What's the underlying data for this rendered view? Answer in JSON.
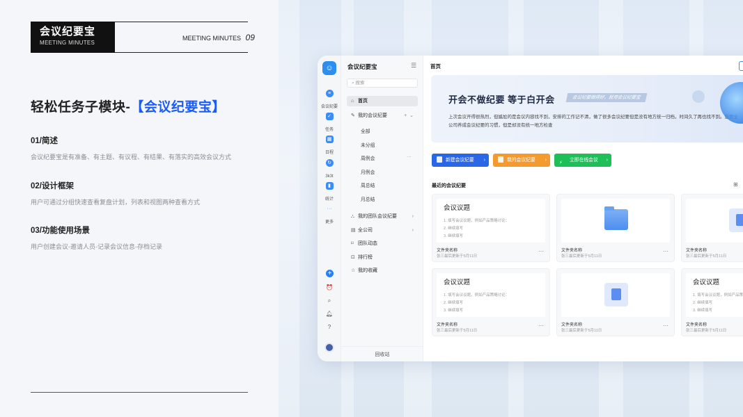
{
  "slide": {
    "brand_title": "会议纪要宝",
    "brand_sub": "MEETING MINUTES",
    "header_label": "MEETING MINUTES",
    "page_num": "09",
    "main_title_prefix": "轻松任务子模块-",
    "main_title_highlight": "【会议纪要宝】",
    "sections": [
      {
        "title": "01/简述",
        "desc": "会议纪要宝是有准备、有主题、有议程、有结果、有落实的高效会议方式"
      },
      {
        "title": "02/设计框架",
        "desc": "用户可通过分组快速查看复盘计划，列表和视图两种查看方式"
      },
      {
        "title": "03/功能使用场景",
        "desc": "用户创建会议-邀请人员-记录会议信息-存档记录"
      }
    ]
  },
  "app": {
    "rail": [
      {
        "label": "会议纪要",
        "icon": "meeting-icon"
      },
      {
        "label": "任务",
        "icon": "task-icon"
      },
      {
        "label": "日程",
        "icon": "calendar-icon"
      },
      {
        "label": "3k3t",
        "icon": "refresh-icon"
      },
      {
        "label": "统计",
        "icon": "stats-icon"
      },
      {
        "label": "更多",
        "icon": "more-icon"
      }
    ],
    "nav": {
      "title": "会议纪要宝",
      "search_placeholder": "搜索",
      "items": {
        "home": "首页",
        "my_meetings": "我的会议纪要",
        "team_meetings": "我的团队会议纪要",
        "company": "全公司",
        "team_activity": "团队动态",
        "ranking": "排行榜",
        "favorites": "我的收藏"
      },
      "subs": [
        "全部",
        "未分组",
        "周例会",
        "月例会",
        "周总结",
        "月总结"
      ],
      "footer": "回收站"
    },
    "content": {
      "title": "首页",
      "banner_title": "开会不做纪要  等于白开会",
      "banner_tag": "会议纪要做得好，就用会议纪要宝",
      "banner_desc": "上次会议开得很热烈，但尴尬的是会议内容找不到，安排的工作记不清，做了很多会议纪要但是没有地方统一归档，时间久了再也找不到。想要全公司养成会议纪要的习惯，但是却没有统一地方检查",
      "buttons": {
        "new": "新建会议纪要",
        "mine": "我的会议纪要",
        "online": "立即在线会议"
      },
      "recent_title": "最近的会议纪要",
      "card": {
        "heading": "会议议题",
        "lines": [
          "1. 填写会议议题，例如产品策略讨论：",
          "2. 继续填写",
          "3. 继续填写"
        ],
        "name": "文件夹名称",
        "meta": "张三最后更新于5月11日"
      }
    }
  }
}
